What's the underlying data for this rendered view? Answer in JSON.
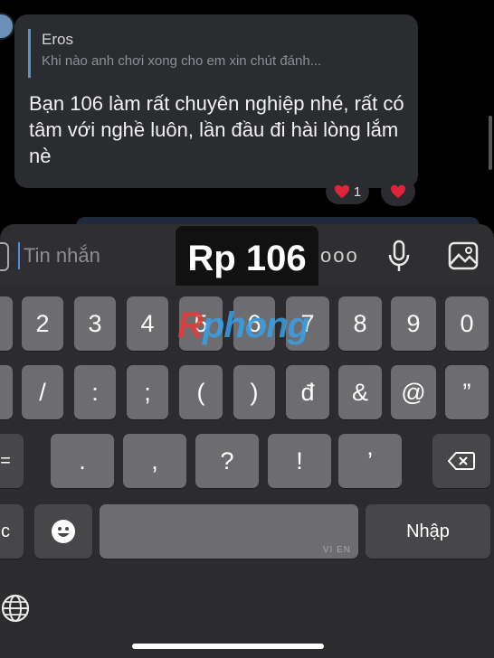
{
  "chat": {
    "reply_name": "Eros",
    "reply_text": "Khi nào anh chơi xong cho em xin chút đánh...",
    "message": "Bạn 106 làm rất chuyên nghiệp nhé, rất có tâm với nghề luôn, lần đầu đi hài lòng lắm nè",
    "reactions": [
      {
        "emoji": "heart",
        "count": "1"
      },
      {
        "emoji": "heart",
        "count": ""
      }
    ]
  },
  "input": {
    "placeholder": "Tin nhắn",
    "more": "ooo"
  },
  "overlay_badge": "Rp 106",
  "watermark": {
    "part1": "R",
    "part2": "phong"
  },
  "keyboard": {
    "row1": [
      "2",
      "3",
      "4",
      "5",
      "6",
      "7",
      "8",
      "9",
      "0"
    ],
    "row2": [
      "/",
      ":",
      ";",
      "(",
      ")",
      "đ",
      "&",
      "@",
      "”"
    ],
    "row3": [
      "=",
      ".",
      ",",
      "?",
      "!",
      "’"
    ],
    "row4_left": "c",
    "space_hint": "VI EN",
    "return_label": "Nhập"
  },
  "colors": {
    "accent": "#4a90e2",
    "key": "#6d6d70",
    "key_dark": "#474749",
    "heart": "#e0243a"
  }
}
